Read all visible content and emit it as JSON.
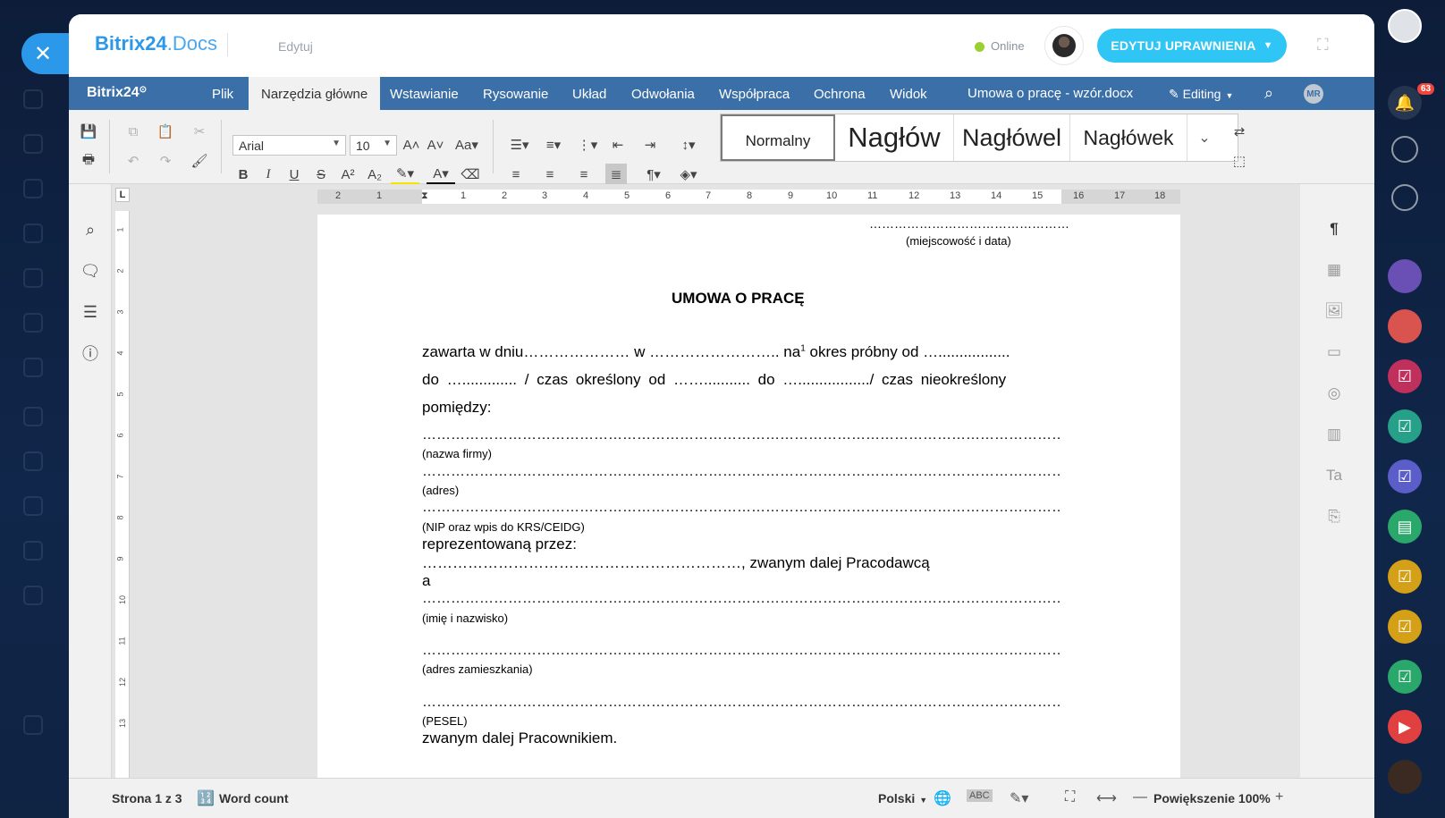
{
  "header": {
    "brand_main": "Bitrix24",
    "brand_sub": ".Docs",
    "mode": "Edytuj",
    "status": "Online",
    "permissions_button": "EDYTUJ UPRAWNIENIA"
  },
  "menubar": {
    "logo": "Bitrix24",
    "items": [
      "Plik",
      "Narzędzia główne",
      "Wstawianie",
      "Rysowanie",
      "Układ",
      "Odwołania",
      "Współpraca",
      "Ochrona",
      "Widok"
    ],
    "document_title": "Umowa o pracę - wzór.docx",
    "editing_label": "Editing",
    "user_initials": "MR"
  },
  "toolbar": {
    "font_name": "Arial",
    "font_size": "10",
    "styles": [
      "Normalny",
      "Nagłów",
      "Nagłówel",
      "Nagłówek"
    ]
  },
  "ruler": {
    "h_numbers": [
      "2",
      "1",
      "1",
      "2",
      "3",
      "4",
      "5",
      "6",
      "7",
      "8",
      "9",
      "10",
      "11",
      "12",
      "13",
      "14",
      "15",
      "16",
      "17",
      "18"
    ],
    "v_numbers": [
      "1",
      "2",
      "3",
      "4",
      "5",
      "6",
      "7",
      "8",
      "9",
      "10",
      "11",
      "12",
      "13"
    ],
    "corner": "L"
  },
  "document": {
    "place_date_dots": "…………………………………………",
    "place_date_label": "(miejscowość i data)",
    "title": "UMOWA O PRACĘ",
    "para1_line1": "zawarta w dniu…………………  w  ……………………..  na",
    "para1_sup": "1",
    "para1_line1_end": " okres próbny od ….................",
    "para1_line2": "do  …............. / czas określony od  ……........... do  …................./ czas nieokreślony",
    "para1_line3": "pomiędzy:",
    "company_dots": "…………………………………………………………………………………………………………………………………………………………………………………………",
    "company_label": "(nazwa firmy)",
    "address_dots": "………………………………………………………………………………………………………………………………………………………………………………………",
    "address_label": "(adres)",
    "nip_dots": "………………………………………………………………………………………………………………………………………………………………………………………",
    "nip_label": "(NIP oraz wpis do KRS/CEIDG)",
    "represented": "reprezentowaną przez:",
    "employer_line": "………………………………………………………, zwanym dalej Pracodawcą",
    "and": "a",
    "name_dots": "…………………………………………………………………………………………………………………………………………………………………………………………",
    "name_label": "(imię i nazwisko)",
    "home_dots": "………………………………………………………………………………………………………………………………………………………………………………………",
    "home_label": "(adres zamieszkania)",
    "pesel_dots": "………………………………………………………………………………………………………………………………………………………………………………………,",
    "pesel_label": "(PESEL)",
    "employee_line": "zwanym dalej Pracownikiem."
  },
  "statusbar": {
    "page": "Strona 1 z 3",
    "word_count": "Word count",
    "language": "Polski",
    "zoom": "Powiększenie 100%"
  },
  "notifications": {
    "count": "63"
  }
}
